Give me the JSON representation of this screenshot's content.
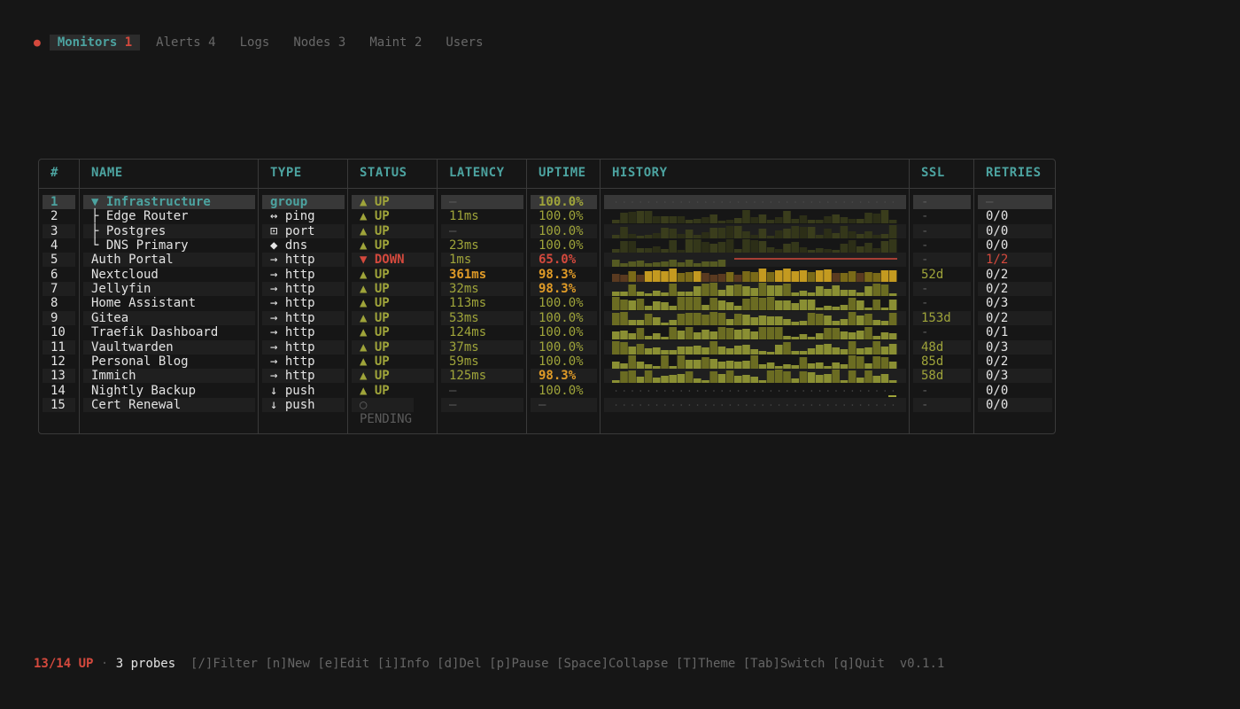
{
  "status_dot": "●",
  "tabs": [
    {
      "name": "Monitors",
      "count": "1"
    },
    {
      "name": "Alerts",
      "count": "4"
    },
    {
      "name": "Logs",
      "count": ""
    },
    {
      "name": "Nodes",
      "count": "3"
    },
    {
      "name": "Maint",
      "count": "2"
    },
    {
      "name": "Users",
      "count": ""
    }
  ],
  "table": {
    "headers": {
      "num": "#",
      "name": "NAME",
      "type": "TYPE",
      "status": "STATUS",
      "latency": "LATENCY",
      "uptime": "UPTIME",
      "history": "HISTORY",
      "ssl": "SSL",
      "retries": "RETRIES"
    },
    "rows": [
      {
        "num": "1",
        "name": "▼ Infrastructure",
        "type": "group",
        "status": "▲ UP",
        "latency": "—",
        "uptime": "100.0%",
        "ssl": "-",
        "retries": "—",
        "state": "group",
        "history": "dots"
      },
      {
        "num": "2",
        "name": "├ Edge Router",
        "type": "↔ ping",
        "status": "▲ UP",
        "latency": "11ms",
        "uptime": "100.0%",
        "ssl": "-",
        "retries": "0/0",
        "state": "up",
        "history": "dark"
      },
      {
        "num": "3",
        "name": "├ Postgres",
        "type": "⊡ port",
        "status": "▲ UP",
        "latency": "—",
        "uptime": "100.0%",
        "ssl": "-",
        "retries": "0/0",
        "state": "up",
        "history": "dark"
      },
      {
        "num": "4",
        "name": "└ DNS Primary",
        "type": "◆ dns",
        "status": "▲ UP",
        "latency": "23ms",
        "uptime": "100.0%",
        "ssl": "-",
        "retries": "0/0",
        "state": "up",
        "history": "dark"
      },
      {
        "num": "5",
        "name": "Auth Portal",
        "type": "→ http",
        "status": "▼ DOWN",
        "latency": "1ms",
        "uptime": "65.0%",
        "ssl": "-",
        "retries": "1/2",
        "state": "down",
        "history": "down"
      },
      {
        "num": "6",
        "name": "Nextcloud",
        "type": "→ http",
        "status": "▲ UP",
        "latency": "361ms",
        "uptime": "98.3%",
        "ssl": "52d",
        "retries": "0/2",
        "state": "slow",
        "history": "orange"
      },
      {
        "num": "7",
        "name": "Jellyfin",
        "type": "→ http",
        "status": "▲ UP",
        "latency": "32ms",
        "uptime": "98.3%",
        "ssl": "-",
        "retries": "0/2",
        "state": "warn",
        "history": "green"
      },
      {
        "num": "8",
        "name": "Home Assistant",
        "type": "→ http",
        "status": "▲ UP",
        "latency": "113ms",
        "uptime": "100.0%",
        "ssl": "-",
        "retries": "0/3",
        "state": "up",
        "history": "green"
      },
      {
        "num": "9",
        "name": "Gitea",
        "type": "→ http",
        "status": "▲ UP",
        "latency": "53ms",
        "uptime": "100.0%",
        "ssl": "153d",
        "retries": "0/2",
        "state": "up",
        "history": "green"
      },
      {
        "num": "10",
        "name": "Traefik Dashboard",
        "type": "→ http",
        "status": "▲ UP",
        "latency": "124ms",
        "uptime": "100.0%",
        "ssl": "-",
        "retries": "0/1",
        "state": "up",
        "history": "green"
      },
      {
        "num": "11",
        "name": "Vaultwarden",
        "type": "→ http",
        "status": "▲ UP",
        "latency": "37ms",
        "uptime": "100.0%",
        "ssl": "48d",
        "retries": "0/3",
        "state": "up",
        "history": "green"
      },
      {
        "num": "12",
        "name": "Personal Blog",
        "type": "→ http",
        "status": "▲ UP",
        "latency": "59ms",
        "uptime": "100.0%",
        "ssl": "85d",
        "retries": "0/2",
        "state": "up",
        "history": "green"
      },
      {
        "num": "13",
        "name": "Immich",
        "type": "→ http",
        "status": "▲ UP",
        "latency": "125ms",
        "uptime": "98.3%",
        "ssl": "58d",
        "retries": "0/3",
        "state": "warn",
        "history": "green"
      },
      {
        "num": "14",
        "name": "Nightly Backup",
        "type": "↓ push",
        "status": "▲ UP",
        "latency": "—",
        "uptime": "100.0%",
        "ssl": "-",
        "retries": "0/0",
        "state": "up",
        "history": "dots"
      },
      {
        "num": "15",
        "name": "Cert Renewal",
        "type": "↓ push",
        "status": "○ PENDING",
        "latency": "—",
        "uptime": "—",
        "ssl": "-",
        "retries": "0/0",
        "state": "pending",
        "history": "dots"
      }
    ]
  },
  "footer": {
    "up_count": "13/14 UP",
    "separator": " · ",
    "probes": "3 probes",
    "hints": "  [/]Filter [n]New [e]Edit [i]Info [d]Del [p]Pause [Space]Collapse [T]Theme [Tab]Switch [q]Quit  v0.1.1"
  },
  "colors": {
    "accent": "#4ca3a0",
    "up": "#9fa43a",
    "down": "#d4493d",
    "warn": "#e09b27",
    "muted": "#5c5c5c",
    "background": "#161616"
  }
}
